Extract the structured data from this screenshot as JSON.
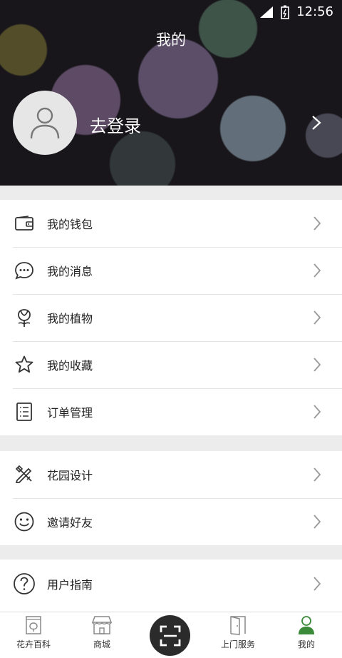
{
  "status_bar": {
    "time": "12:56"
  },
  "header": {
    "title": "我的",
    "login_label": "去登录"
  },
  "menu_group_1": [
    {
      "label": "我的钱包",
      "icon": "wallet-icon"
    },
    {
      "label": "我的消息",
      "icon": "message-icon"
    },
    {
      "label": "我的植物",
      "icon": "plant-icon"
    },
    {
      "label": "我的收藏",
      "icon": "star-icon"
    },
    {
      "label": "订单管理",
      "icon": "order-list-icon"
    }
  ],
  "menu_group_2": [
    {
      "label": "花园设计",
      "icon": "design-tools-icon"
    },
    {
      "label": "邀请好友",
      "icon": "smile-icon"
    }
  ],
  "menu_group_3": [
    {
      "label": "用户指南",
      "icon": "help-icon"
    }
  ],
  "tabbar": {
    "tabs": [
      {
        "label": "花卉百科",
        "icon": "flower-book-icon"
      },
      {
        "label": "商城",
        "icon": "shop-icon"
      },
      {
        "label": "上门服务",
        "icon": "door-icon"
      },
      {
        "label": "我的",
        "icon": "user-icon"
      }
    ],
    "center_button": "scan-icon",
    "active_color": "#3a8a3a"
  }
}
